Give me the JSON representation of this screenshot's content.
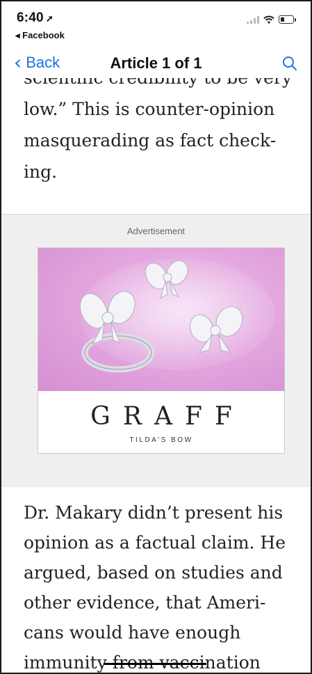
{
  "status_bar": {
    "time": "6:40",
    "location_arrow": "location-arrow-icon",
    "back_to_app": "◂ Facebook"
  },
  "nav": {
    "back_label": "Back",
    "title": "Article 1 of 1",
    "accent_color": "#1a73e8"
  },
  "article": {
    "clipped_line": "scientific credibility to be very",
    "top_lines": [
      "low.” This is counter-opinion",
      "masquerading as fact check-",
      "ing."
    ],
    "bottom_lines": [
      "Dr. Makary didn’t present his",
      "opinion as a factual claim. He",
      "argued, based on studies and",
      "other evidence, that Ameri-",
      "cans would have enough"
    ],
    "last_line_before": "immunity",
    "last_line_struck": " from vacci",
    "last_line_after": "nation"
  },
  "advertisement": {
    "label": "Advertisement",
    "brand": "GRAFF",
    "collection": "TILDA'S BOW",
    "image_bg": "#e3a6df"
  }
}
